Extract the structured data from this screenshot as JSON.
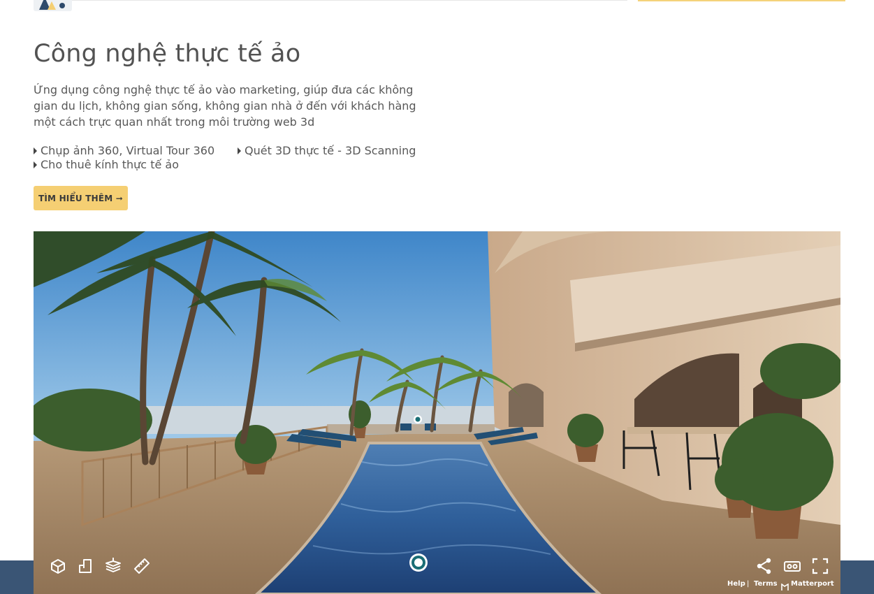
{
  "page": {
    "title": "Công nghệ thực tế ảo",
    "description": "Ứng dụng công nghệ thực tế ảo vào marketing, giúp đưa các không gian du lịch, không gian sống, không gian nhà ở đến với khách hàng một cách trực quan nhất trong môi trường web 3d",
    "features": [
      "Chụp ảnh 360, Virtual Tour 360",
      "Quét 3D thực tế - 3D Scanning",
      "Cho thuê kính thực tế ảo"
    ],
    "cta_label": "TÌM HIỂU THÊM ➞"
  },
  "viewer": {
    "controls_left": [
      "dollhouse-icon",
      "floorplan-icon",
      "floor-selector-icon",
      "measure-icon"
    ],
    "controls_right": [
      "share-icon",
      "vr-icon",
      "fullscreen-icon"
    ],
    "links": {
      "help": "Help",
      "separator": "|",
      "terms": "Terms",
      "brand": "Matterport"
    }
  },
  "colors": {
    "accent": "#f5cf73",
    "footer": "#3a5575",
    "text": "#525252"
  }
}
